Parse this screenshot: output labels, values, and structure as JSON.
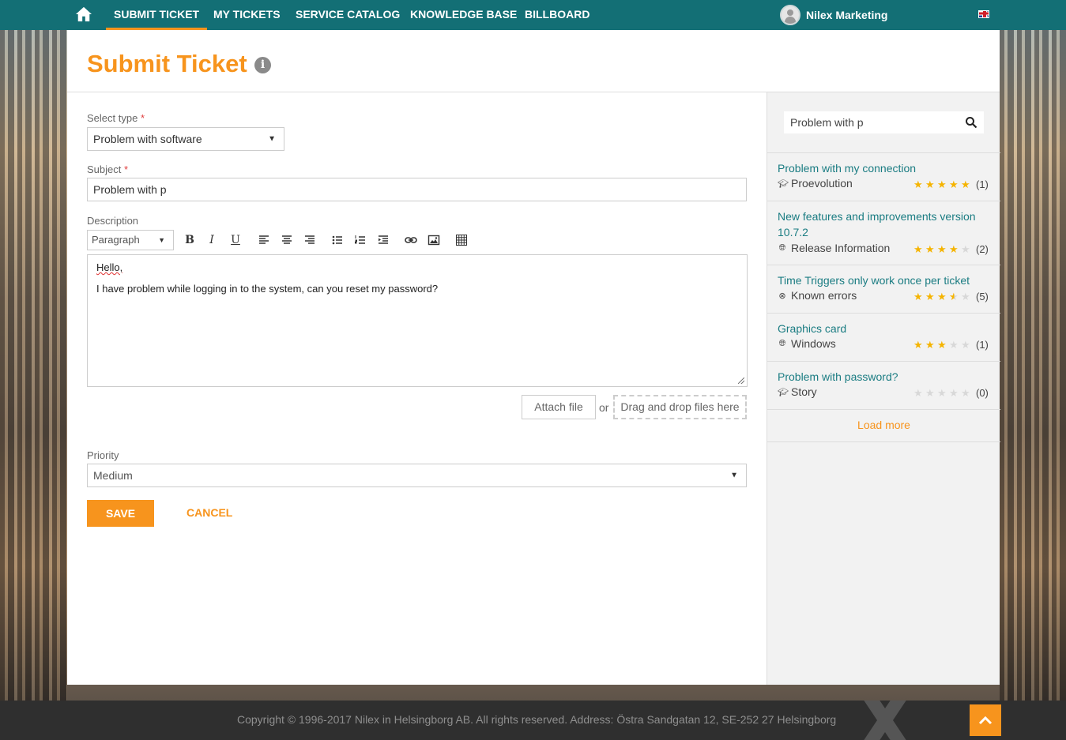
{
  "nav": {
    "items": [
      {
        "label": "SUBMIT TICKET",
        "active": true
      },
      {
        "label": "MY TICKETS"
      },
      {
        "label": "SERVICE CATALOG"
      },
      {
        "label": "KNOWLEDGE BASE"
      },
      {
        "label": "BILLBOARD"
      }
    ],
    "user_name": "Nilex Marketing"
  },
  "page": {
    "title": "Submit Ticket",
    "info_icon": "i"
  },
  "form": {
    "type_label": "Select type",
    "type_value": "Problem with software",
    "subject_label": "Subject",
    "subject_value": "Problem with p",
    "required_mark": "*",
    "description_label": "Description",
    "paragraph_select": "Paragraph",
    "toolbar": {
      "bold": "B",
      "italic": "I",
      "underline": "U"
    },
    "description_lines": [
      "Hello,",
      "I have problem while logging in to the system, can you reset my password?"
    ],
    "attach_label": "Attach file",
    "or_label": "or",
    "drop_label": "Drag and drop files here",
    "priority_label": "Priority",
    "priority_value": "Medium",
    "save_label": "SAVE",
    "cancel_label": "CANCEL"
  },
  "sidebar": {
    "search_value": "Problem with p",
    "suggestions": [
      {
        "title": "Problem with my connection",
        "category": "Proevolution",
        "icon": "graduation-cap-icon",
        "rating": 5,
        "count": "(1)"
      },
      {
        "title": "New features and improvements version 10.7.2",
        "category": "Release Information",
        "icon": "globe-icon",
        "rating": 4,
        "count": "(2)"
      },
      {
        "title": "Time Triggers only work once per ticket",
        "category": "Known errors",
        "icon": "circle-x-icon",
        "rating": 3.5,
        "count": "(5)"
      },
      {
        "title": "Graphics card",
        "category": "Windows",
        "icon": "globe-icon",
        "rating": 3,
        "count": "(1)"
      },
      {
        "title": "Problem with password?",
        "category": "Story",
        "icon": "graduation-cap-icon",
        "rating": 0,
        "count": "(0)"
      }
    ],
    "load_more": "Load more"
  },
  "footer": {
    "copyright": "Copyright © 1996-2017 Nilex in Helsingborg AB. All rights reserved. Address: Östra Sandgatan 12, SE-252 27 Helsingborg"
  },
  "colors": {
    "brand_teal": "#136f75",
    "accent_orange": "#f7941d",
    "link_teal": "#1a7c82",
    "star_gold": "#f5b400"
  }
}
